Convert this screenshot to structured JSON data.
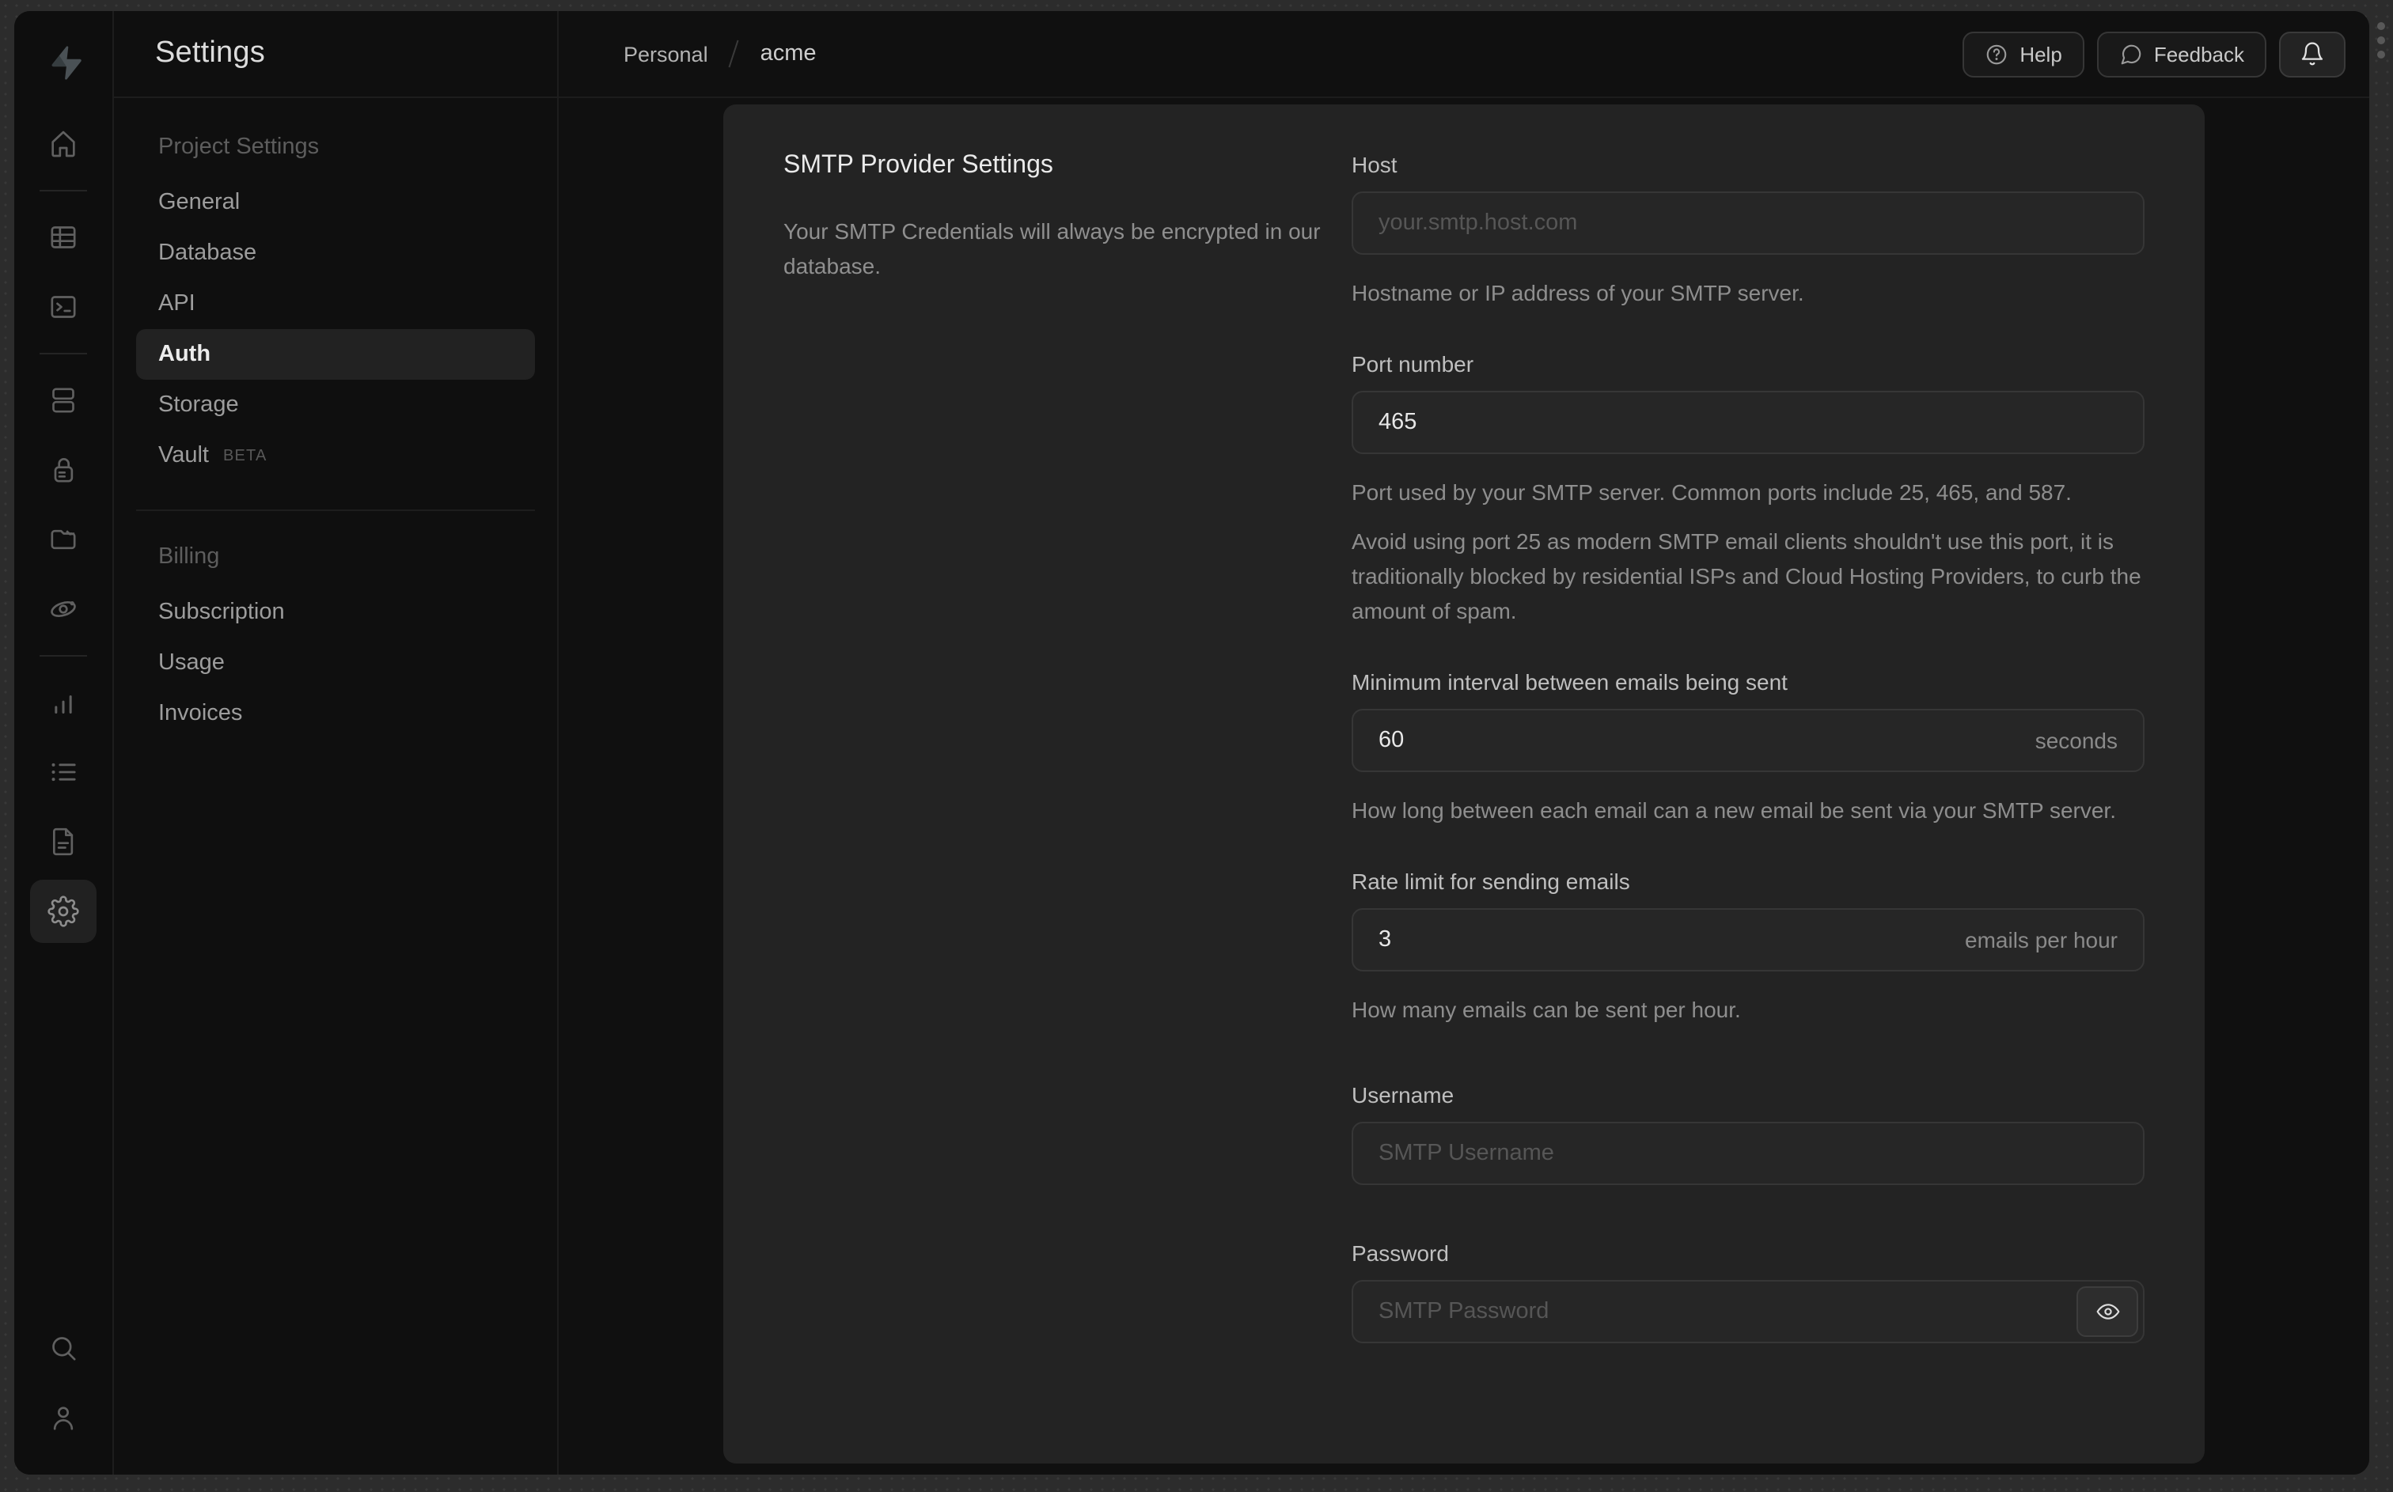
{
  "colors": {
    "frame": "#2c2c2c",
    "window_bg": "#0f0f0f",
    "card_bg": "#232323",
    "input_bg": "#262626",
    "border": "#363636",
    "text_primary": "#ececec",
    "text_muted": "#8f8f8f",
    "logo_grey": "#4b5155"
  },
  "rail_icons": [
    "supabase-logo",
    "home",
    "table-editor",
    "sql-editor",
    "database",
    "auth-lock",
    "storage",
    "edge-functions",
    "reports",
    "logs",
    "docs",
    "settings-gear",
    "search",
    "user"
  ],
  "sidebar": {
    "title": "Settings",
    "sections": [
      {
        "heading": "Project Settings",
        "items": [
          {
            "label": "General"
          },
          {
            "label": "Database"
          },
          {
            "label": "API"
          },
          {
            "label": "Auth",
            "active": true
          },
          {
            "label": "Storage"
          },
          {
            "label": "Vault",
            "badge": "BETA"
          }
        ]
      },
      {
        "heading": "Billing",
        "items": [
          {
            "label": "Subscription"
          },
          {
            "label": "Usage"
          },
          {
            "label": "Invoices"
          }
        ]
      }
    ]
  },
  "header": {
    "breadcrumb": {
      "org": "Personal",
      "project": "acme"
    },
    "help_label": "Help",
    "feedback_label": "Feedback"
  },
  "smtp_card": {
    "title": "SMTP Provider Settings",
    "description": "Your SMTP Credentials will always be encrypted in our database.",
    "fields": [
      {
        "label": "Host",
        "value": "",
        "placeholder": "your.smtp.host.com",
        "helpers": [
          "Hostname or IP address of your SMTP server."
        ]
      },
      {
        "label": "Port number",
        "value": "465",
        "helpers": [
          "Port used by your SMTP server. Common ports include 25, 465, and 587.",
          "Avoid using port 25 as modern SMTP email clients shouldn't use this port, it is traditionally blocked by residential ISPs and Cloud Hosting Providers, to curb the amount of spam."
        ]
      },
      {
        "label": "Minimum interval between emails being sent",
        "value": "60",
        "suffix": "seconds",
        "helpers": [
          "How long between each email can a new email be sent via your SMTP server."
        ]
      },
      {
        "label": "Rate limit for sending emails",
        "value": "3",
        "suffix": "emails per hour",
        "helpers": [
          "How many emails can be sent per hour."
        ]
      },
      {
        "label": "Username",
        "value": "",
        "placeholder": "SMTP Username"
      },
      {
        "label": "Password",
        "value": "",
        "placeholder": "SMTP Password"
      }
    ]
  }
}
